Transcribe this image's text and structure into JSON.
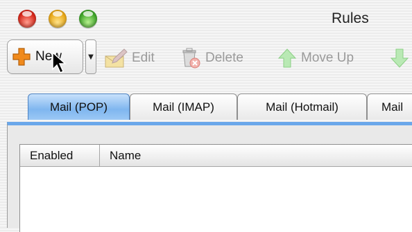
{
  "window": {
    "title": "Rules"
  },
  "toolbar": {
    "new_label": "New",
    "edit_label": "Edit",
    "delete_label": "Delete",
    "move_up_label": "Move Up"
  },
  "tabs": [
    {
      "label": "Mail (POP)",
      "selected": true
    },
    {
      "label": "Mail (IMAP)",
      "selected": false
    },
    {
      "label": "Mail (Hotmail)",
      "selected": false
    },
    {
      "label": "Mail",
      "selected": false
    }
  ],
  "table": {
    "columns": [
      "Enabled",
      "Name"
    ],
    "rows": []
  },
  "colors": {
    "accent": "#6aa7ea",
    "tab_selected": "#7fb6ef",
    "new_plus": "#f08a1c"
  }
}
